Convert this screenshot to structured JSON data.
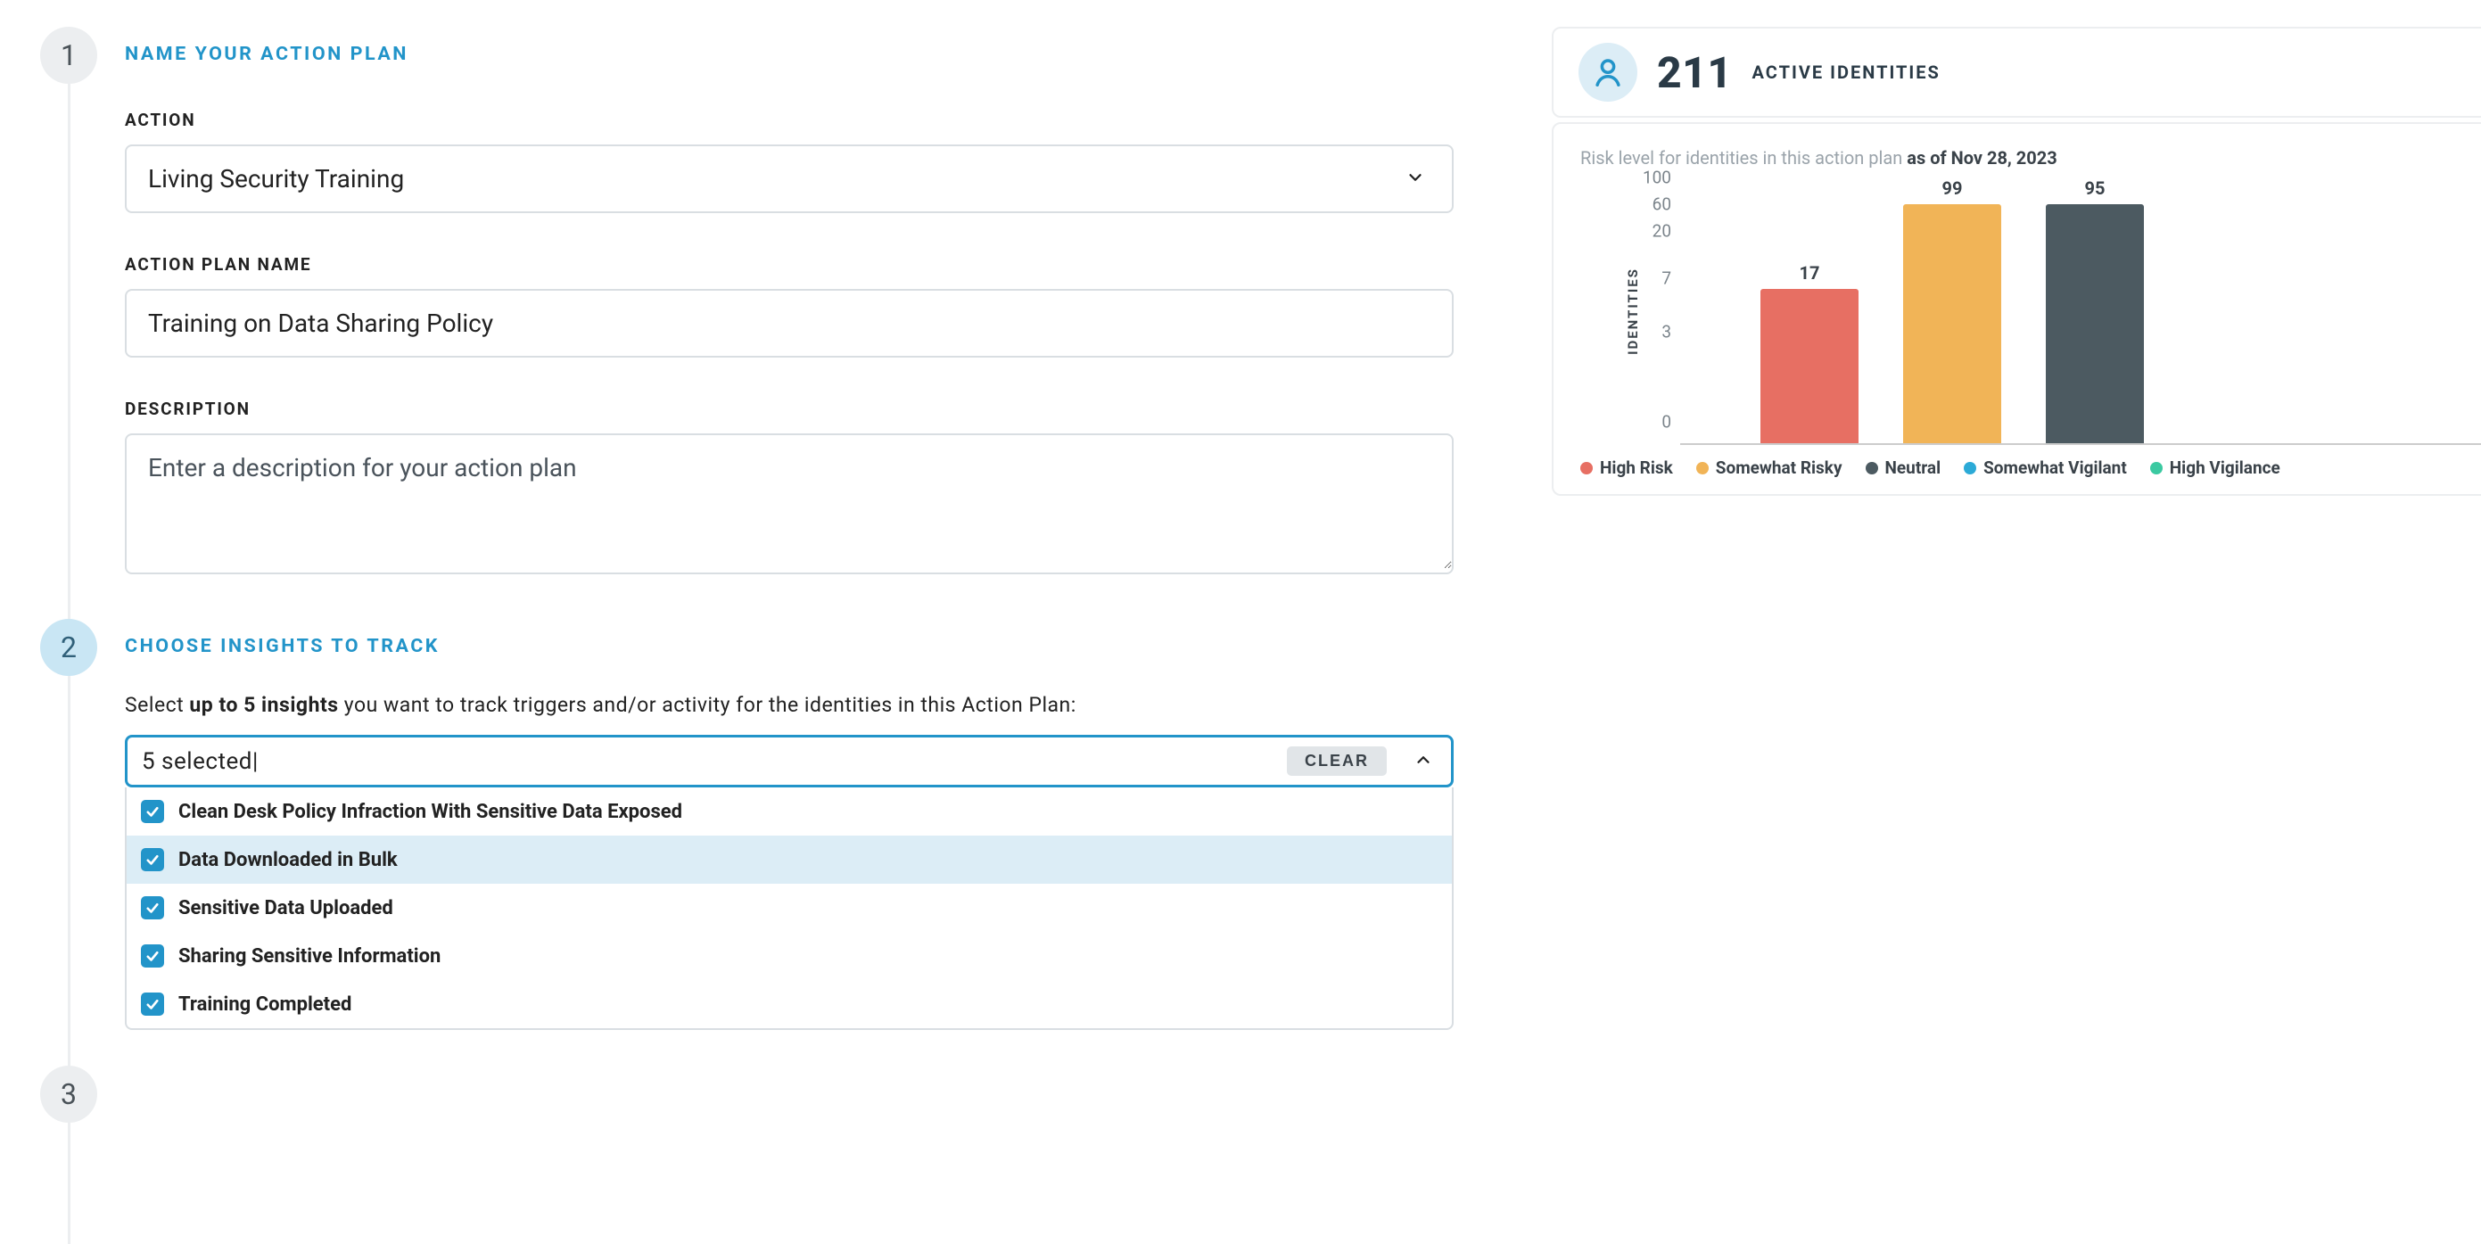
{
  "steps": {
    "s1": {
      "num": "1",
      "title": "NAME YOUR ACTION PLAN"
    },
    "s2": {
      "num": "2",
      "title": "CHOOSE INSIGHTS TO TRACK"
    },
    "s3": {
      "num": "3"
    }
  },
  "fields": {
    "action_label": "ACTION",
    "action_value": "Living Security Training",
    "plan_name_label": "ACTION PLAN NAME",
    "plan_name_value": "Training on Data Sharing Policy",
    "description_label": "DESCRIPTION",
    "description_placeholder": "Enter a description for your action plan"
  },
  "insights": {
    "instruction_pre": "Select ",
    "instruction_bold": "up to 5 insights",
    "instruction_post": " you want to track triggers and/or activity for the identities in this Action Plan:",
    "selected_text": "5 selected|",
    "clear_label": "CLEAR",
    "options": [
      {
        "label": "Clean Desk Policy Infraction With Sensitive Data Exposed",
        "checked": true,
        "highlight": false
      },
      {
        "label": "Data Downloaded in Bulk",
        "checked": true,
        "highlight": true
      },
      {
        "label": "Sensitive Data Uploaded",
        "checked": true,
        "highlight": false
      },
      {
        "label": "Sharing Sensitive Information",
        "checked": true,
        "highlight": false
      },
      {
        "label": "Training Completed",
        "checked": true,
        "highlight": false
      }
    ]
  },
  "identities": {
    "count": "211",
    "label": "ACTIVE IDENTITIES"
  },
  "chart": {
    "subtitle_pre": "Risk level for identities in this action plan ",
    "subtitle_bold": "as of Nov 28, 2023",
    "y_label": "IDENTITIES"
  },
  "chart_data": {
    "type": "bar",
    "title": "Risk level for identities in this action plan as of Nov 28, 2023",
    "ylabel": "IDENTITIES",
    "xlabel": "",
    "y_ticks": [
      100,
      60,
      20,
      7,
      3,
      0
    ],
    "ylim": [
      0,
      100
    ],
    "categories": [
      "High Risk",
      "Somewhat Risky",
      "Neutral",
      "Somewhat Vigilant",
      "High Vigilance"
    ],
    "values": [
      17,
      99,
      95,
      0,
      0
    ],
    "colors": {
      "High Risk": "#e76f63",
      "Somewhat Risky": "#f1b457",
      "Neutral": "#4c5a61",
      "Somewhat Vigilant": "#2caad7",
      "High Vigilance": "#3bc9a1"
    },
    "visible_bars": [
      "High Risk",
      "Somewhat Risky",
      "Neutral"
    ],
    "bar_heights_pct": {
      "High Risk": 58,
      "Somewhat Risky": 91,
      "Neutral": 91
    }
  }
}
